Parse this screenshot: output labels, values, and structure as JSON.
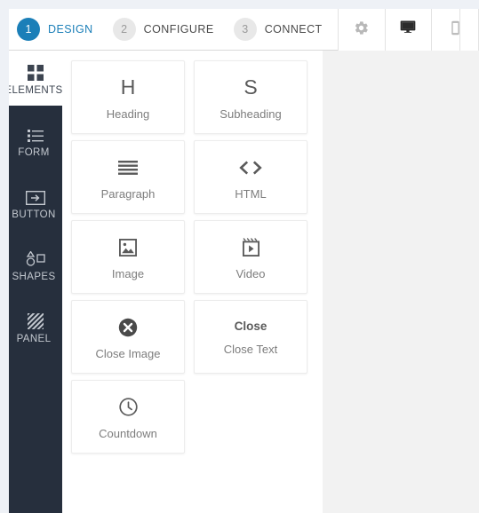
{
  "toolbar": {
    "steps": [
      {
        "number": "1",
        "label": "DESIGN",
        "state": "active"
      },
      {
        "number": "2",
        "label": "CONFIGURE",
        "state": "inactive"
      },
      {
        "number": "3",
        "label": "CONNECT",
        "state": "inactive"
      }
    ],
    "tools": [
      {
        "name": "settings-gear-icon",
        "state": "inactive"
      },
      {
        "name": "desktop-preview-icon",
        "state": "active"
      },
      {
        "name": "mobile-preview-icon",
        "state": "inactive"
      }
    ],
    "accent_color": "#1b7fb8",
    "inactive_badge_color": "#e8e8e8"
  },
  "sidebar": {
    "background_color": "#262f3d",
    "items": [
      {
        "label": "ELEMENTS",
        "icon": "grid-squares-icon",
        "state": "active"
      },
      {
        "label": "FORM",
        "icon": "form-list-icon",
        "state": "inactive"
      },
      {
        "label": "BUTTON",
        "icon": "button-arrow-icon",
        "state": "inactive"
      },
      {
        "label": "SHAPES",
        "icon": "shapes-icon",
        "state": "inactive"
      },
      {
        "label": "PANEL",
        "icon": "panel-hatch-icon",
        "state": "inactive"
      }
    ]
  },
  "panel": {
    "background_color": "#ffffff",
    "cards": [
      {
        "label": "Heading",
        "glyph": "H",
        "icon": "heading-letter-icon"
      },
      {
        "label": "Subheading",
        "glyph": "S",
        "icon": "subheading-letter-icon"
      },
      {
        "label": "Paragraph",
        "glyph": "",
        "icon": "paragraph-lines-icon"
      },
      {
        "label": "HTML",
        "glyph": "<>",
        "icon": "html-code-icon"
      },
      {
        "label": "Image",
        "glyph": "",
        "icon": "image-picture-icon"
      },
      {
        "label": "Video",
        "glyph": "",
        "icon": "video-play-icon"
      },
      {
        "label": "Close Image",
        "glyph": "",
        "icon": "close-circle-x-icon"
      },
      {
        "label": "Close Text",
        "glyph": "Close",
        "icon": "close-text-icon"
      },
      {
        "label": "Countdown",
        "glyph": "",
        "icon": "clock-countdown-icon"
      }
    ]
  },
  "canvas": {
    "background_color": "#f2f2f2"
  }
}
